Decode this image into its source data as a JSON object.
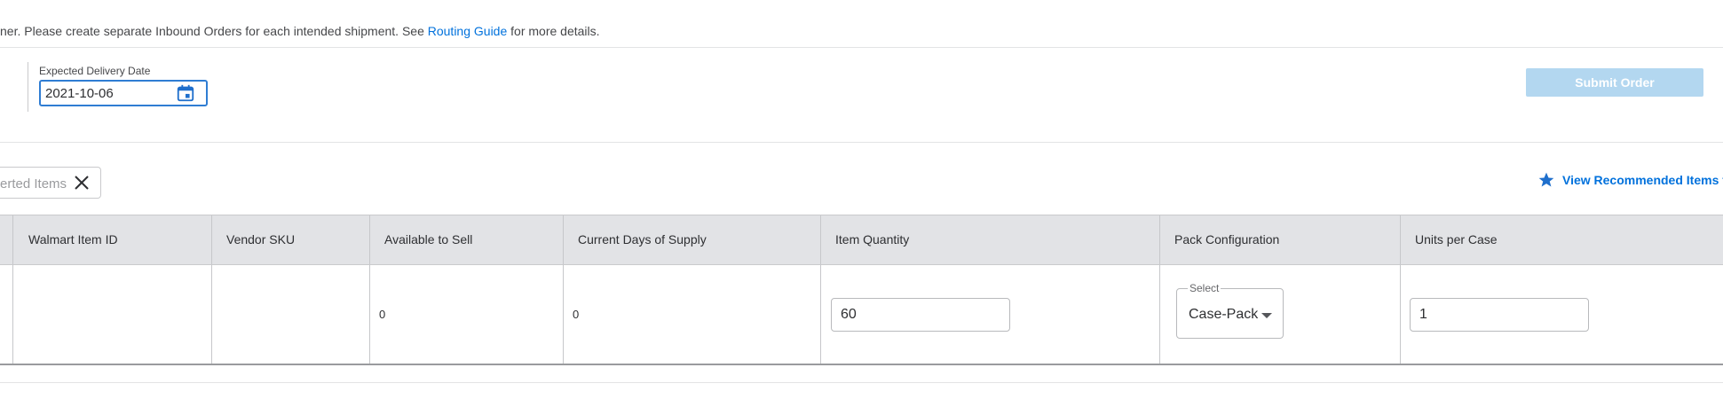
{
  "notice": {
    "prefix": "ner. Please create separate Inbound Orders for each intended shipment. See ",
    "link": "Routing Guide",
    "suffix": " for more details."
  },
  "delivery": {
    "label": "Expected Delivery Date",
    "value": "2021-10-06",
    "icon": "calendar-icon"
  },
  "submit": {
    "label": "Submit Order",
    "state": "disabled"
  },
  "search": {
    "placeholder": "erted Items",
    "clear_icon": "close-icon"
  },
  "recommended": {
    "label": "View Recommended Items to R",
    "icon": "star-icon"
  },
  "table": {
    "headers": [
      "Walmart Item ID",
      "Vendor SKU",
      "Available to Sell",
      "Current Days of Supply",
      "Item Quantity",
      "Pack Configuration",
      "Units per Case"
    ],
    "rows": [
      {
        "walmart_item_id": "",
        "vendor_sku": "",
        "available_to_sell": "0",
        "days_of_supply": "0",
        "item_quantity": "60",
        "pack_config_label": "Select",
        "pack_config_value": "Case-Pack",
        "units_per_case": "1"
      }
    ]
  },
  "colors": {
    "accent": "#0071dc",
    "submit_disabled": "#b3d7f0",
    "header_bg": "#e2e3e6"
  }
}
